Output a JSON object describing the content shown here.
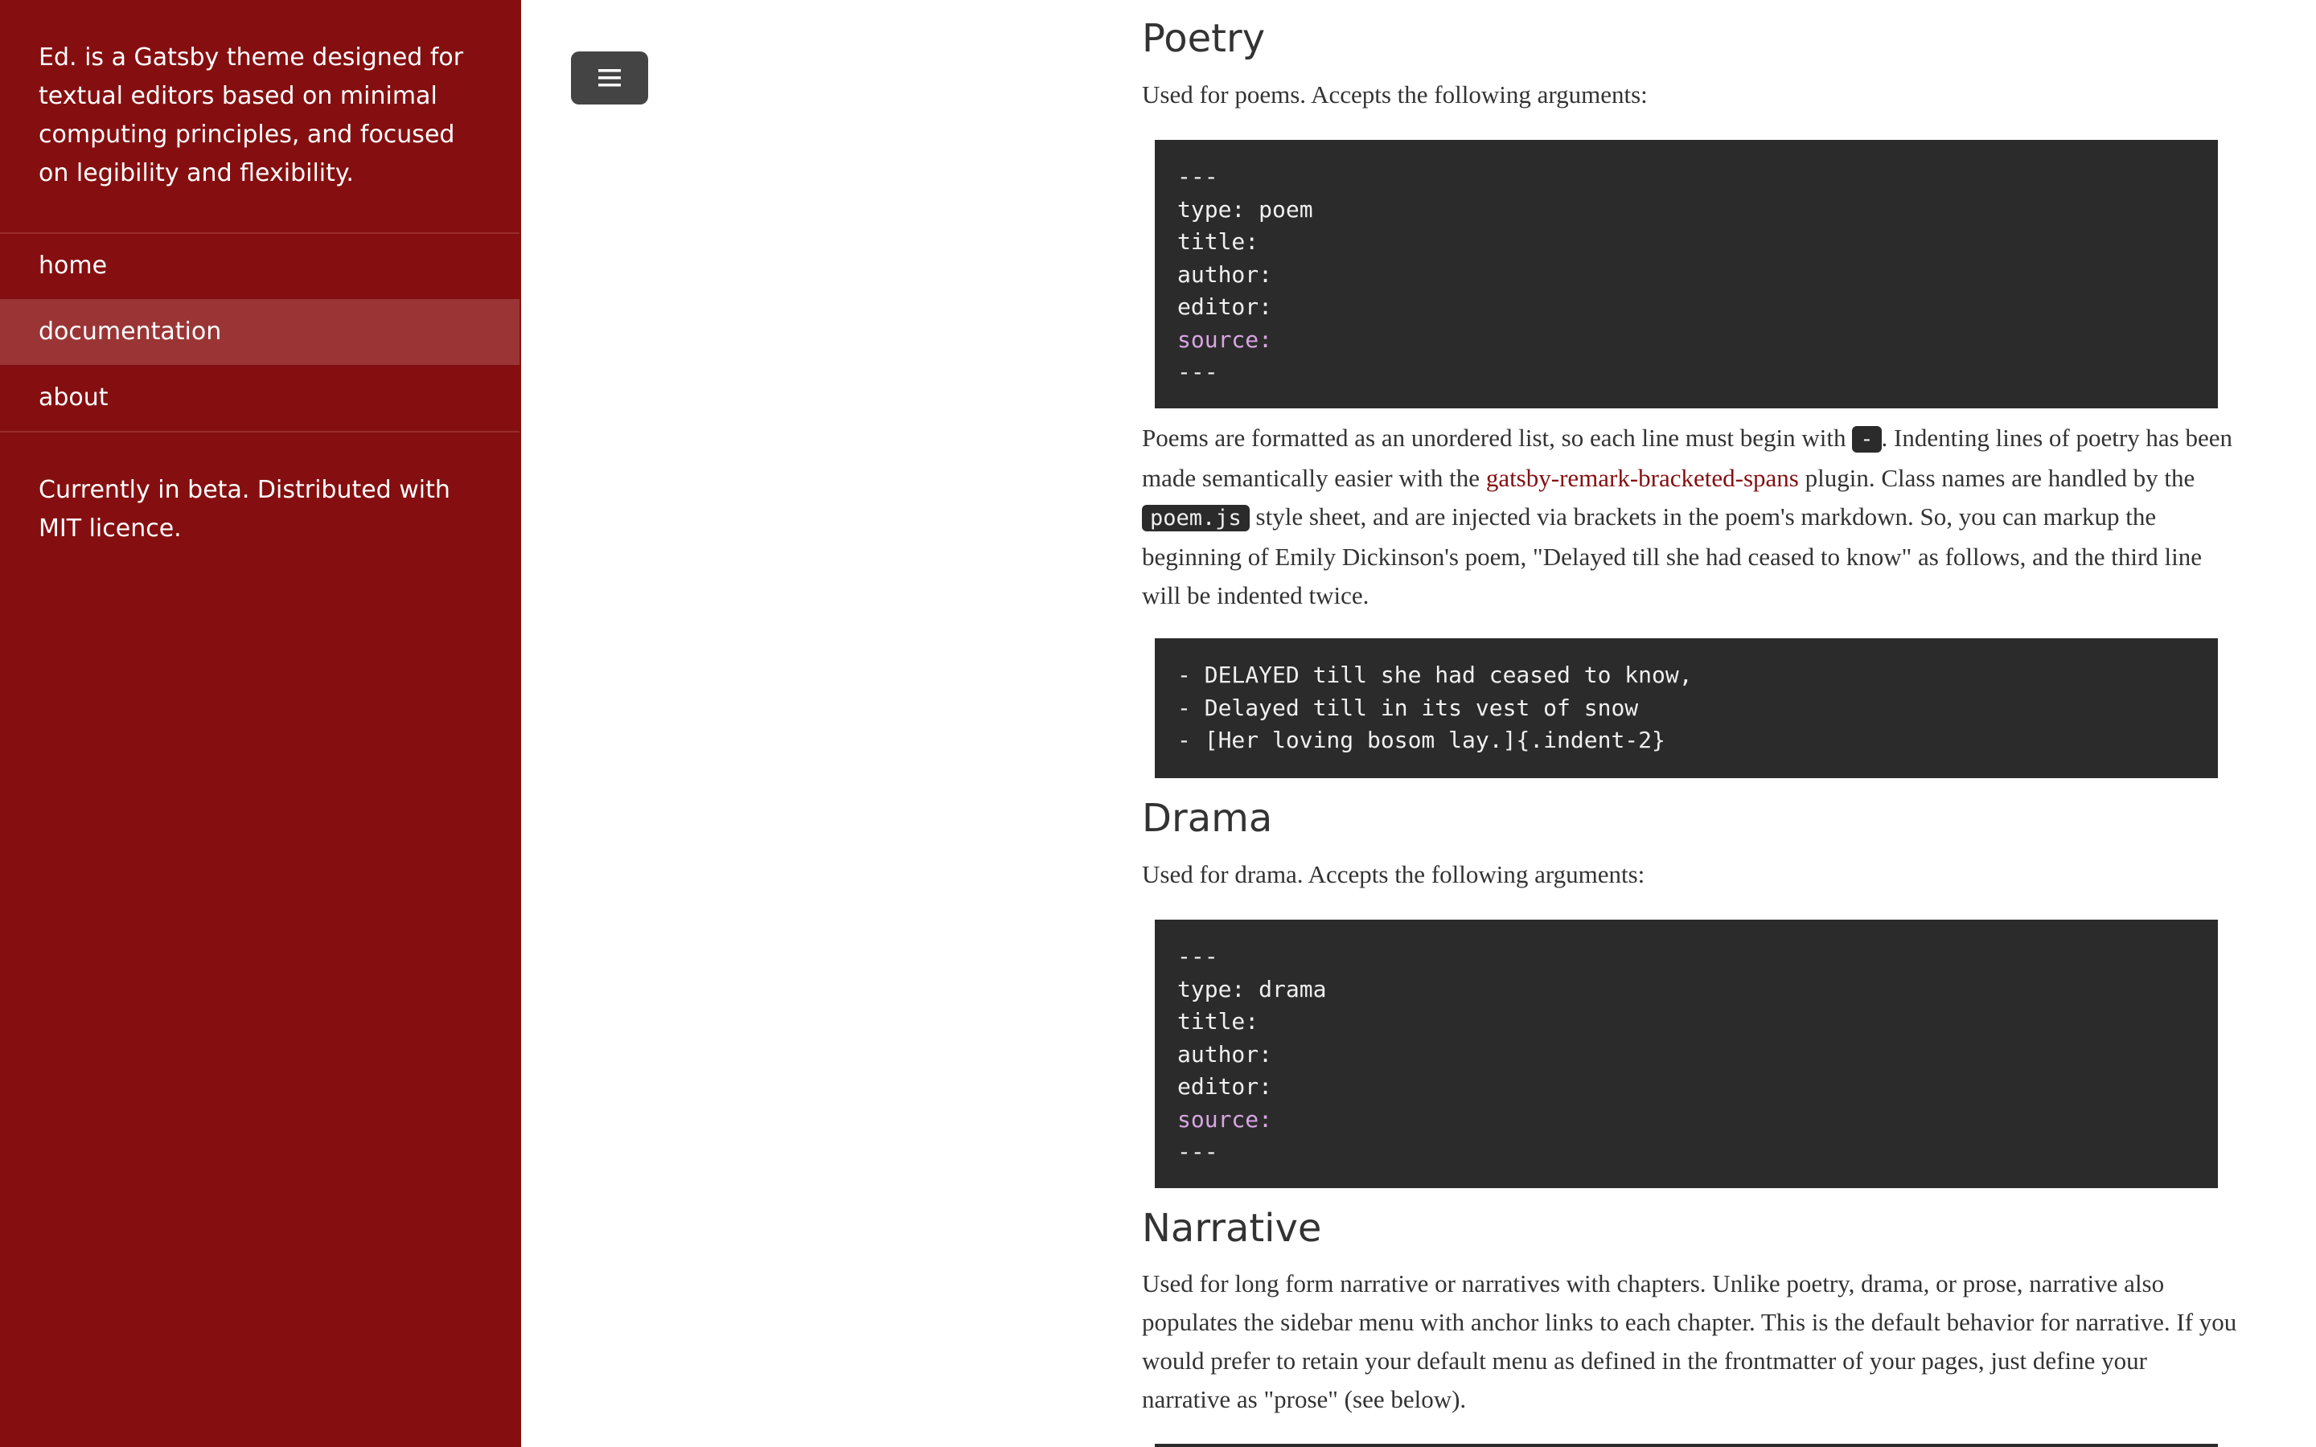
{
  "sidebar": {
    "intro": "Ed. is a Gatsby theme designed for textual editors based on minimal computing principles, and focused on legibility and flexibility.",
    "nav": [
      {
        "label": "home",
        "active": false
      },
      {
        "label": "documentation",
        "active": true
      },
      {
        "label": "about",
        "active": false
      }
    ],
    "footer": "Currently in beta. Distributed with MIT licence."
  },
  "toolbar": {
    "menu_icon": "menu-icon"
  },
  "colors": {
    "sidebar_bg": "#850F10",
    "nav_active_bg": "#9B3535",
    "code_bg": "#2b2b2b",
    "link": "#850F10",
    "yaml_key": "#d8a6e2"
  },
  "poetry": {
    "heading": "Poetry",
    "intro": "Used for poems. Accepts the following arguments:",
    "code": [
      "---",
      "type: poem",
      "title:",
      "author:",
      "editor:",
      "source:",
      "---"
    ],
    "para_1": "Poems are formatted as an unordered list, so each line must begin with ",
    "inline_dash": "-",
    "para_2": ". Indenting lines of poetry has been made semantically easier with the ",
    "link_text": "gatsby-remark-bracketed-spans",
    "para_3": " plugin. Class names are handled by the ",
    "inline_file": "poem.js",
    "para_4": " style sheet, and are injected via brackets in the poem's markdown. So, you can markup the beginning of Emily Dickinson's poem, \"Delayed till she had ceased to know\" as follows, and the third line will be indented twice.",
    "example_code": [
      "- DELAYED till she had ceased to know,",
      "- Delayed till in its vest of snow",
      "- [Her loving bosom lay.]{.indent-2}"
    ]
  },
  "drama": {
    "heading": "Drama",
    "intro": "Used for drama. Accepts the following arguments:",
    "code": [
      "---",
      "type: drama",
      "title:",
      "author:",
      "editor:",
      "source:",
      "---"
    ]
  },
  "narrative": {
    "heading": "Narrative",
    "text": "Used for long form narrative or narratives with chapters. Unlike poetry, drama, or prose, narrative also populates the sidebar menu with anchor links to each chapter. This is the default behavior for narrative. If you would prefer to retain your default menu as defined in the frontmatter of your pages, just define your narrative as \"prose\" (see below)."
  }
}
